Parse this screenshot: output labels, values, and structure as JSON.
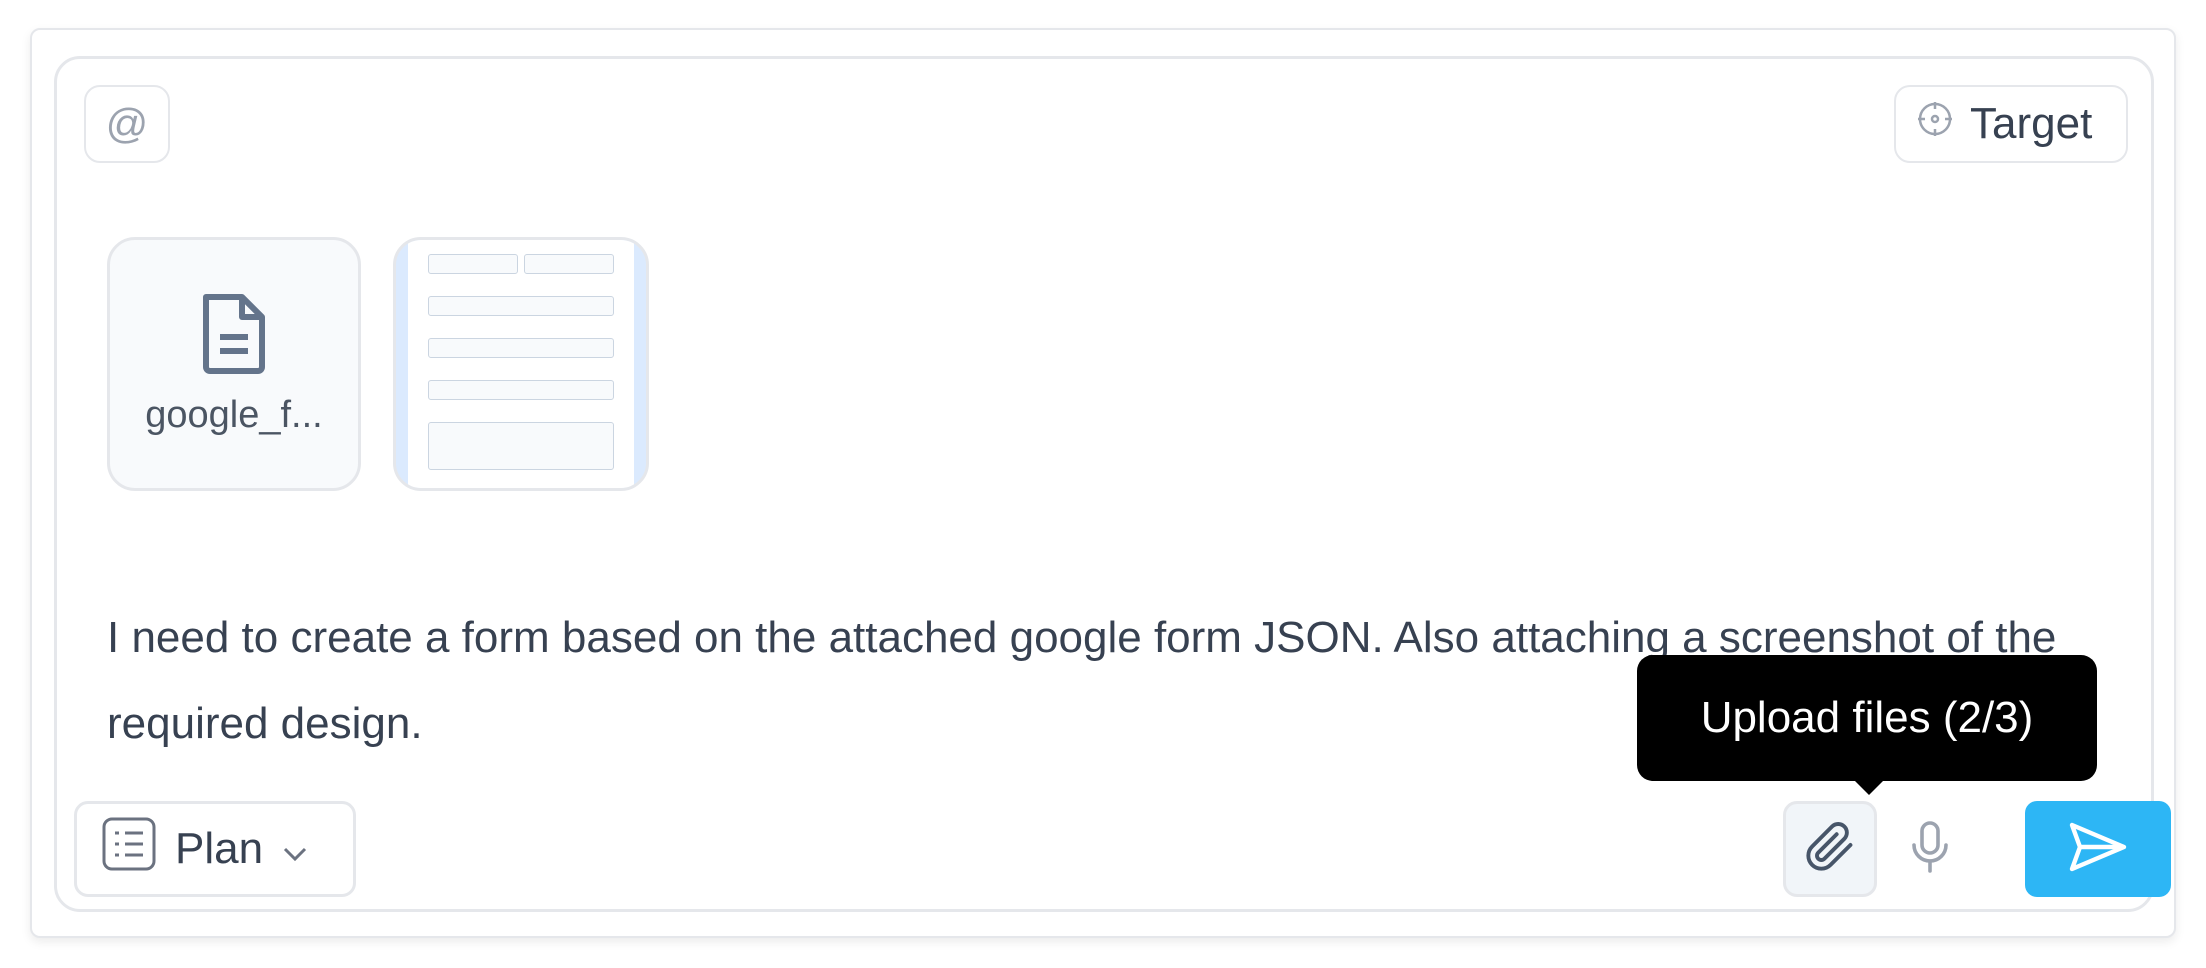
{
  "toolbar": {
    "mention_symbol": "@",
    "target_label": "Target"
  },
  "attachments": [
    {
      "type": "file",
      "name": "google_f...",
      "icon": "document-icon"
    },
    {
      "type": "image",
      "icon": "image-thumbnail"
    }
  ],
  "message": {
    "text": "I need to create a form based on the attached google form JSON. Also attaching a screenshot of the required design."
  },
  "mode": {
    "label": "Plan",
    "icon": "list-icon"
  },
  "tooltip": {
    "text": "Upload files (2/3)"
  },
  "actions": {
    "attach_icon": "paperclip-icon",
    "mic_icon": "microphone-icon",
    "send_icon": "send-icon"
  },
  "colors": {
    "send_button": "#2db6f5",
    "tooltip_bg": "#000000",
    "border": "#e5e7eb",
    "text": "#374151"
  }
}
